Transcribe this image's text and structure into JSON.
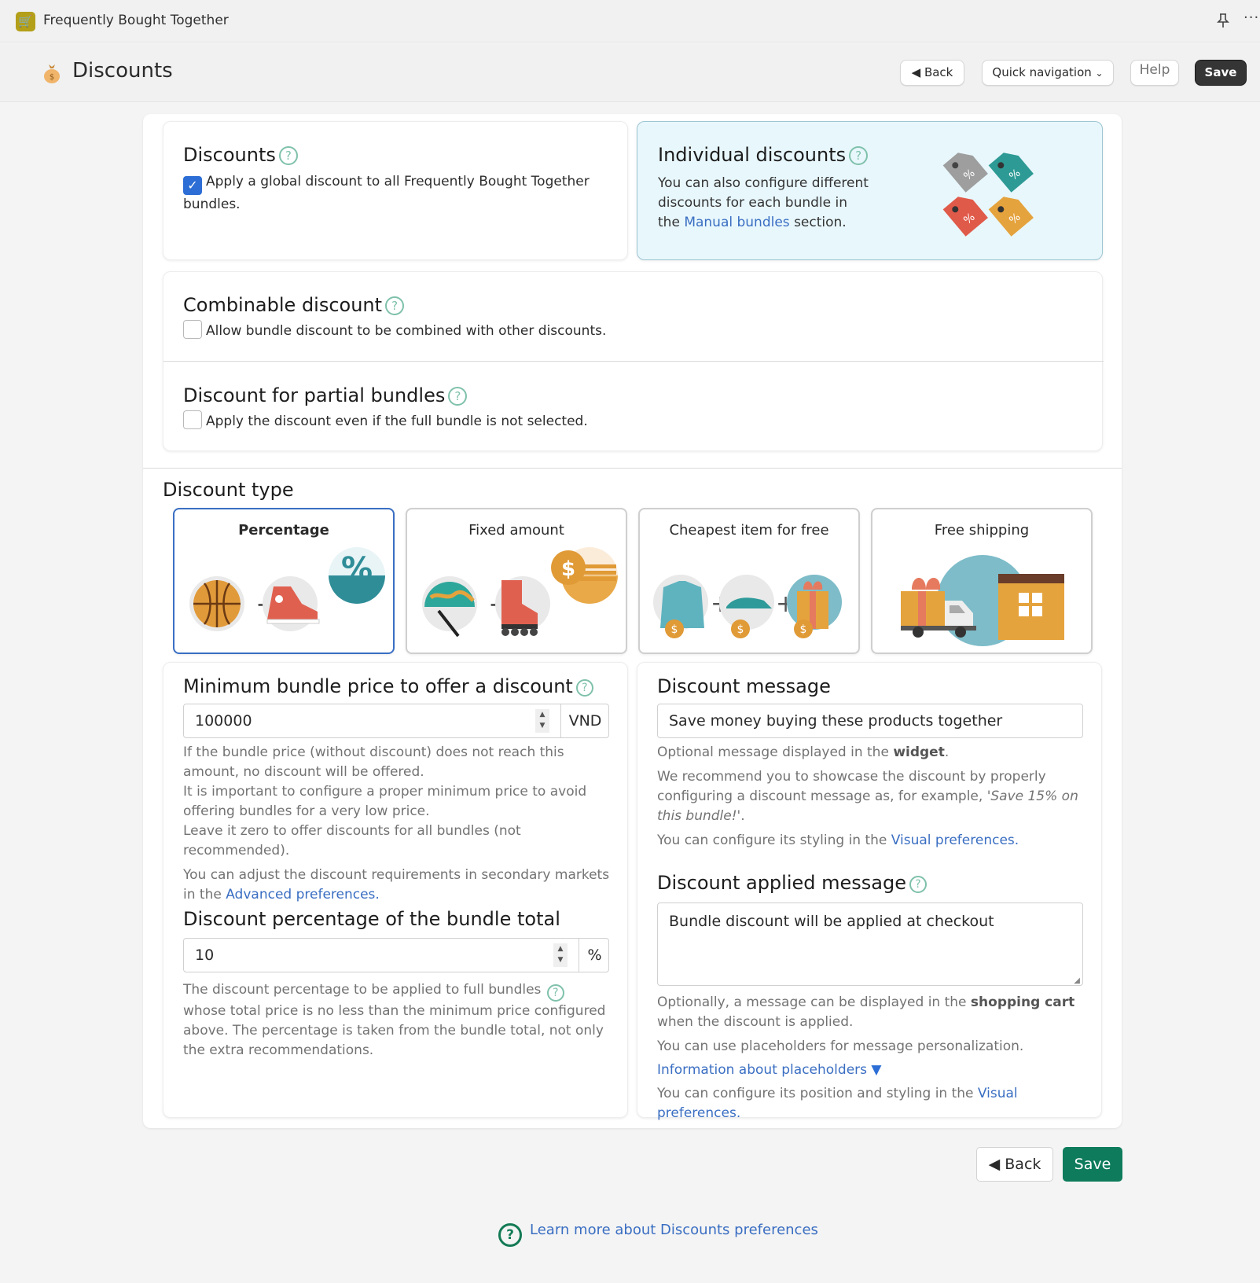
{
  "app": {
    "title": "Frequently Bought Together",
    "icon": "cart-plus-icon"
  },
  "window_actions": {
    "pin": "pin-icon",
    "more": "more-icon"
  },
  "header": {
    "title": "Discounts",
    "icon": "money-bag-icon",
    "back_label": "Back",
    "quick_nav_label": "Quick navigation",
    "help_label": "Help",
    "save_label": "Save"
  },
  "discounts": {
    "title": "Discounts",
    "checkbox_label": "Apply a global discount to all Frequently Bought Together bundles.",
    "checked": true
  },
  "individual": {
    "title": "Individual discounts",
    "text_before": "You can also configure different discounts for each bundle in the ",
    "link": "Manual bundles",
    "text_after": " section.",
    "bg": "#e8f7fc"
  },
  "combinable": {
    "title": "Combinable discount",
    "checkbox_label": "Allow bundle discount to be combined with other discounts.",
    "checked": false
  },
  "partial": {
    "title": "Discount for partial bundles",
    "checkbox_label": "Apply the discount even if the full bundle is not selected.",
    "checked": false
  },
  "discount_type": {
    "title": "Discount type",
    "options": [
      {
        "label": "Percentage",
        "selected": true
      },
      {
        "label": "Fixed amount",
        "selected": false
      },
      {
        "label": "Cheapest item for free",
        "selected": false
      },
      {
        "label": "Free shipping",
        "selected": false
      }
    ]
  },
  "min_price": {
    "title": "Minimum bundle price to offer a discount",
    "value": "100000",
    "currency": "VND",
    "help1": "If the bundle price (without discount) does not reach this amount, no discount will be offered.",
    "help2": "It is important to configure a proper minimum price to avoid offering bundles for a very low price.",
    "help3": "Leave it zero to offer discounts for all bundles (not recommended).",
    "help4": "You can adjust the discount requirements in secondary markets in the ",
    "help4_link": "Advanced preferences",
    "help4_end": "."
  },
  "percentage": {
    "title": "Discount percentage of the bundle total",
    "value": "10",
    "unit": "%",
    "help_a": "The discount percentage to be applied to full bundles ",
    "help_b": " whose total price is no less than the minimum price configured above. The percentage is taken from the bundle total, not only the extra recommendations."
  },
  "discount_message": {
    "title": "Discount message",
    "value": "Save money buying these products together",
    "help1_a": "Optional message displayed in the ",
    "help1_bold": "widget",
    "help1_end": ".",
    "help2_a": "We recommend you to showcase the discount by properly configuring a discount message as, for example, ",
    "help2_italic": "'Save 15% on this bundle!'",
    "help2_end": ".",
    "help3_a": "You can configure its styling in the ",
    "help3_link": "Visual preferences",
    "help3_end": "."
  },
  "applied_message": {
    "title": "Discount applied message",
    "value": "Bundle discount will be applied at checkout",
    "help1_a": "Optionally, a message can be displayed in the ",
    "help1_bold": "shopping cart",
    "help1_end": " when the discount is applied.",
    "help2": "You can use placeholders for message personalization.",
    "placeholders_link": "Information about placeholders",
    "help3_a": "You can configure its position and styling in the ",
    "help3_link": "Visual preferences",
    "help3_end": "."
  },
  "footer": {
    "back_label": "Back",
    "save_label": "Save",
    "save_color": "#0e7c5c",
    "learn_more": "Learn more about Discounts preferences"
  }
}
